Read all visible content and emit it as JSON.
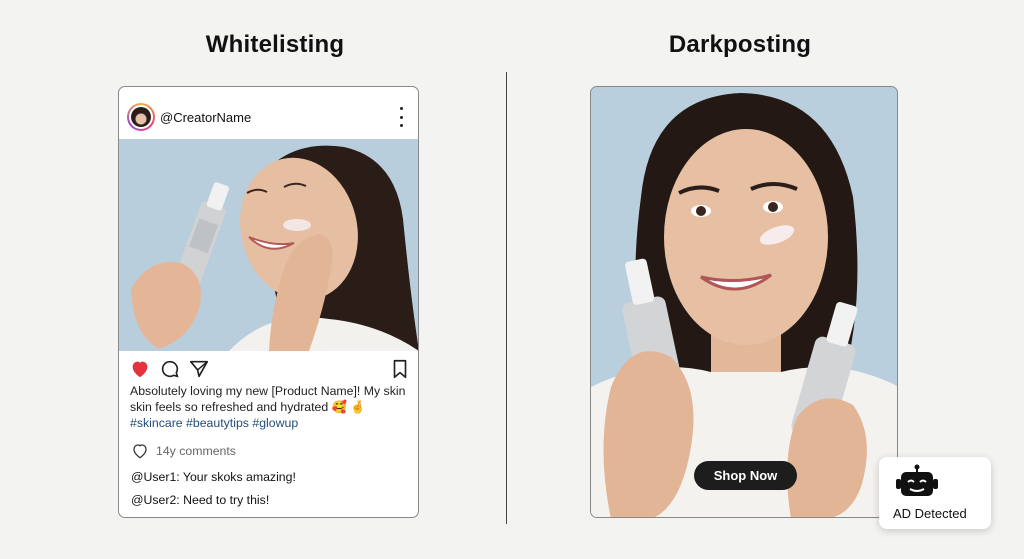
{
  "left": {
    "title": "Whitelisting",
    "username": "@CreatorName",
    "caption_text": "Absolutely loving my new [Product Name]! My skin skin feels so refreshed and hydrated 🥰 🤞",
    "hashtags": "#skincare #beautytips #glowup",
    "comments_count": "14y comments",
    "comments": [
      "@User1: Your skoks amazing!",
      "@User2: Need to try this!"
    ]
  },
  "right": {
    "title": "Darkposting",
    "cta_label": "Shop Now",
    "badge_label": "AD Detected"
  },
  "colors": {
    "heart": "#e4333e",
    "hashtag": "#234d7a",
    "cta_bg": "#1d1d1d",
    "photo_bg": "#b8cedd"
  },
  "icons": [
    "heart-icon",
    "comment-icon",
    "share-icon",
    "bookmark-icon",
    "more-options-icon",
    "robot-icon"
  ]
}
